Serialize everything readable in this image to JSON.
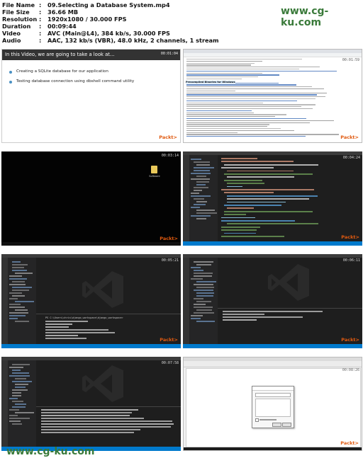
{
  "header": {
    "rows": [
      {
        "key": "File Name",
        "value": "09.Selecting a Database System.mp4"
      },
      {
        "key": "File Size",
        "value": "36.66 MB"
      },
      {
        "key": "Resolution",
        "value": "1920x1080 / 30.000 FPS"
      },
      {
        "key": "Duration",
        "value": "00:09:44"
      },
      {
        "key": "Video",
        "value": "AVC (Main@L4), 384 kb/s, 30.000 FPS"
      },
      {
        "key": "Audio",
        "value": "AAC, 132 kb/s (VBR), 48.0 kHz, 2 channels, 1 stream"
      }
    ],
    "watermark_top": "www.cg-ku.com",
    "colon": ":"
  },
  "watermark_bottom": "www.cg-ku.com",
  "brand": "Packt>",
  "slide": {
    "intro": "In this Video, we are going to take a look at...",
    "bullets": [
      "Creating a SQLite database for our application",
      "Testing database connection using dbshell command utility"
    ]
  },
  "timestamps": [
    "00:01:04",
    "00:01:59",
    "00:03:14",
    "00:04:24",
    "00:05:21",
    "00:06:11",
    "00:07:58",
    "00:08:26"
  ],
  "desktop_icon_label": "Software",
  "web": {
    "section_title": "Precompiled Binaries for Windows"
  },
  "terminal": {
    "path": "PS C:\\Users\\chris\\django_workspace\\django_workspace>"
  },
  "colors": {
    "vscode_bg": "#1e1e1e",
    "vscode_status": "#007acc",
    "packt_orange": "#e05a10",
    "watermark_green": "#3a7a3a"
  }
}
